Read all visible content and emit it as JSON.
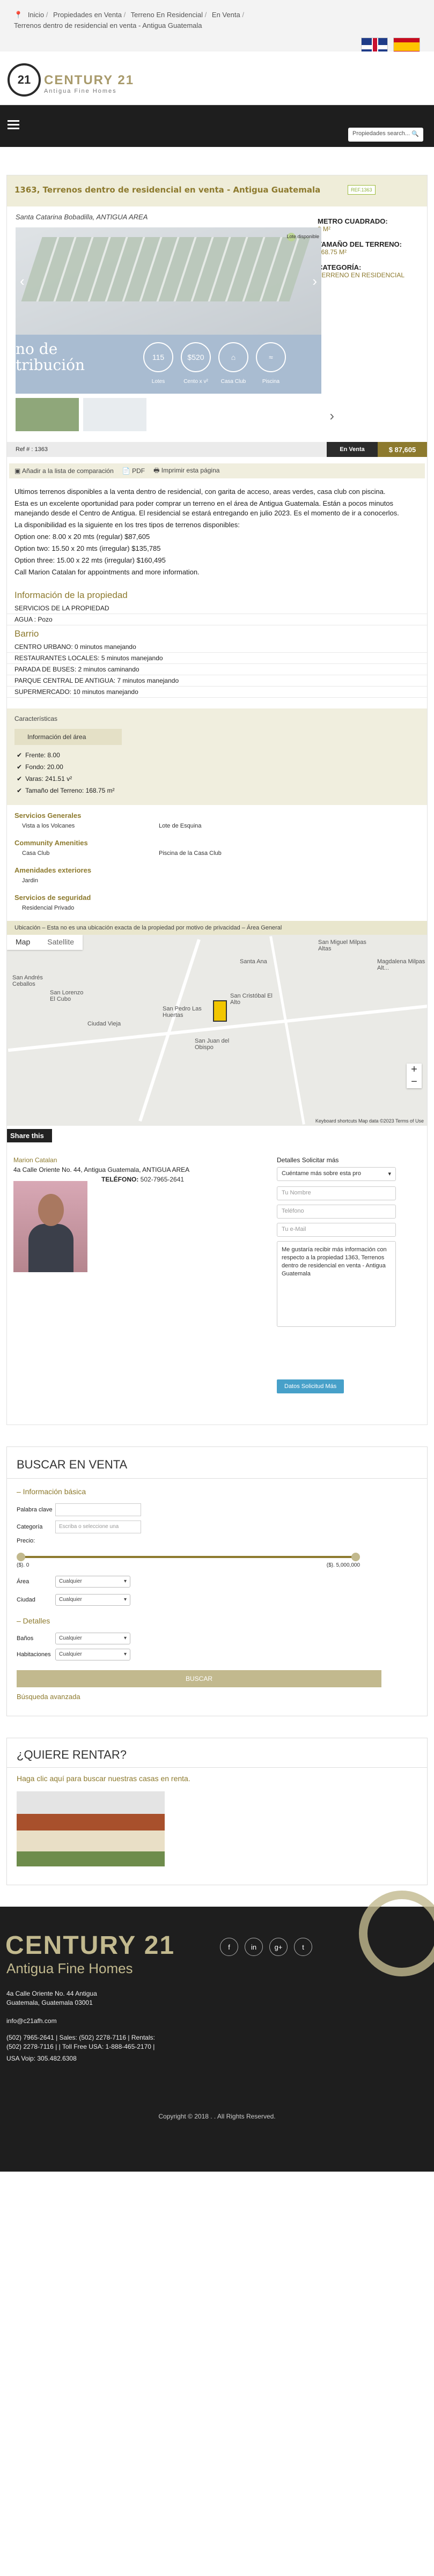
{
  "breadcrumb": {
    "items": [
      "Inicio",
      "Propiedades en Venta",
      "Terreno En Residencial",
      "En Venta"
    ],
    "current": "Terrenos dentro de residencial en venta - Antigua Guatemala"
  },
  "brand": {
    "name": "CENTURY 21",
    "tagline": "Antigua Fine Homes",
    "badge": "21"
  },
  "nav": {
    "search_placeholder": "Propiedades search...",
    "search_icon": "search-icon"
  },
  "property": {
    "title": "1363, Terrenos dentro de residencial en venta - Antigua Guatemala",
    "ref_badge": "REF.1363",
    "location": "Santa Catarina Bobadilla, ANTIGUA AREA",
    "metrics": [
      {
        "label": "METRO CUADRADO:",
        "value": "0 M²"
      },
      {
        "label": "TAMAÑO DEL TERRENO:",
        "value": "168.75 M²"
      },
      {
        "label": "CATEGORÍA:",
        "value": "TERRENO EN RESIDENCIAL"
      }
    ],
    "plan_legend": "Lote disponible",
    "amenity_text": "no de tribución",
    "amenities": [
      {
        "value": "115",
        "label": "Lotes"
      },
      {
        "value": "$520",
        "label": "Cento x v²"
      },
      {
        "value": "",
        "label": "Casa Club"
      },
      {
        "value": "",
        "label": "Piscina"
      }
    ],
    "ref": "Ref # : 1363",
    "status": "En Venta",
    "price": "$ 87,605"
  },
  "actions": [
    "Añadir a la lista de comparación",
    "PDF",
    "Imprimir esta página"
  ],
  "description": [
    "Ultimos terrenos disponibles a la venta dentro de residencial, con garita de acceso, areas verdes, casa club con piscina.",
    "Esta es un excelente oportunidad para poder comprar un terreno en el área de Antigua Guatemala. Están a pocos minutos manejando desde el Centro de Antigua. El residencial se estará entregando en julio 2023. Es el momento de ir a conocerlos.",
    "La disponibilidad es la siguiente en los tres tipos de terrenos disponibles:",
    "Option one: 8.00 x 20 mts (regular) $87,605",
    "Option two: 15.50 x 20 mts (irregular) $135,785",
    "Option three: 15.00 x 22 mts (irregular) $160,495",
    "Call Marion Catalan for appointments and more information."
  ],
  "info": {
    "heading": "Información de la propiedad",
    "items": [
      {
        "label": "SERVICIOS DE LA PROPIEDAD",
        "value": ""
      },
      {
        "label": "AGUA :",
        "value": "Pozo"
      }
    ]
  },
  "barrio": {
    "heading": "Barrio",
    "items": [
      {
        "label": "CENTRO URBANO:",
        "value": "0 minutos manejando"
      },
      {
        "label": "RESTAURANTES LOCALES:",
        "value": "5 minutos manejando"
      },
      {
        "label": "PARADA DE BUSES:",
        "value": "2 minutos caminando"
      },
      {
        "label": "PARQUE CENTRAL DE ANTIGUA:",
        "value": "7 minutos manejando"
      },
      {
        "label": "SUPERMERCADO:",
        "value": "10 minutos manejando"
      }
    ]
  },
  "caracteristicas": {
    "heading": "Características",
    "area_tab": "Información del área",
    "checks": [
      "Frente: 8.00",
      "Fondo: 20.00",
      "Varas: 241.51 v²",
      "Tamaño del Terreno: 168.75 m²"
    ],
    "groups": [
      {
        "title": "Servicios Generales",
        "items": [
          "Vista a los Volcanes",
          "Lote de Esquina"
        ]
      },
      {
        "title": "Community Amenities",
        "items": [
          "Casa Club",
          "Piscina de la Casa Club"
        ]
      },
      {
        "title": "Amenidades exteriores",
        "items": [
          "Jardin"
        ]
      },
      {
        "title": "Servicios de seguridad",
        "items": [
          "Residencial Privado"
        ]
      }
    ]
  },
  "map": {
    "note": "Ubicación – Esta no es una ubicación exacta de la propiedad por motivo de privacidad – Área General",
    "tabs": [
      "Map",
      "Satellite"
    ],
    "labels": [
      "San Andrés Ceballos",
      "San Lorenzo El Cubo",
      "Ciudad Vieja",
      "Santa Ana",
      "San Pedro Las Huertas",
      "San Cristóbal El Alto",
      "San Juan del Obispo",
      "San Miguel Milpas Altas",
      "Magdalena Milpas Alt..."
    ],
    "attribution": "Keyboard shortcuts   Map data ©2023   Terms of Use",
    "zoom_in": "+",
    "zoom_out": "−"
  },
  "share_label": "Share this",
  "agent": {
    "name": "Marion Catalan",
    "address": "4a Calle Oriente No. 44, Antigua Guatemala, ANTIGUA AREA",
    "tel_label": "TELÉFONO:",
    "tel": "502-7965-2641"
  },
  "contact": {
    "title": "Detalles Solicitar más",
    "select_value": "Cuéntame más sobre esta pro",
    "name_placeholder": "Tu Nombre",
    "phone_placeholder": "Teléfono",
    "email_placeholder": "Tu e-Mail",
    "message": "Me gustaría recibir más información con respecto a la propiedad 1363, Terrenos dentro de residencial en venta - Antigua Guatemala",
    "button": "Datos Solicitud Más"
  },
  "search": {
    "title": "BUSCAR EN VENTA",
    "basic": "– Información básica",
    "keyword_label": "Palabra clave",
    "category_label": "Categoría",
    "category_placeholder": "Escriba o seleccione una",
    "price_label": "Precio:",
    "price_min": "($). 0",
    "price_max": "($). 5,000,000",
    "area_label": "Área",
    "area_value": "Cualquier",
    "city_label": "Ciudad",
    "city_value": "Cualquier",
    "details": "– Detalles",
    "baths_label": "Baños",
    "baths_value": "Cualquier",
    "rooms_label": "Habitaciones",
    "rooms_value": "Cualquier",
    "button": "BUSCAR",
    "advanced": "Búsqueda avanzada"
  },
  "rent": {
    "title": "¿QUIERE RENTAR?",
    "link": "Haga clic aquí para buscar nuestras casas en renta."
  },
  "footer": {
    "logo": "CENTURY 21",
    "sub": "Antigua Fine Homes",
    "social": [
      "f",
      "in",
      "g+",
      "t"
    ],
    "address_1": "4a Calle Oriente No. 44 Antigua",
    "address_2": "Guatemala, Guatemala 03001",
    "email": "info@c21afh.com",
    "phones_1": "(502) 7965-2641 | Sales: (502) 2278-7116 | Rentals:",
    "phones_2": "(502) 2278-7116 | | Toll Free USA: 1-888-465-2170 |",
    "usa": "USA Voip: 305.482.6308",
    "copyright": "Copyright © 2018 . . All Rights Reserved."
  }
}
